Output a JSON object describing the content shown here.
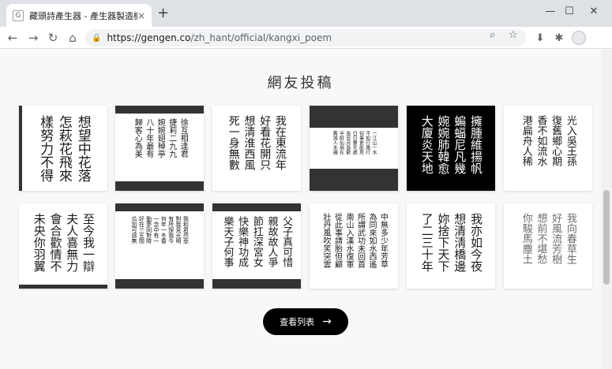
{
  "browser": {
    "tab_title": "藏頭詩產生器 - 產生器製造機⚡ G...",
    "tab_favicon": "G",
    "tab_close": "×",
    "new_tab": "+",
    "url_host": "https://gengen.co",
    "url_path": "/zh_hant/official/kangxi_poem",
    "icons": {
      "back": "←",
      "forward": "→",
      "reload": "↻",
      "home": "⌂",
      "lock": "🔒",
      "zoom": "⌕",
      "star": "☆",
      "download": "⬇",
      "extensions": "✱",
      "minimize": "—",
      "maximize": "☐",
      "close": "✕"
    }
  },
  "page": {
    "section_title": "網友投稿",
    "view_list_label": "查看列表",
    "view_list_arrow": "→"
  },
  "cards": [
    {
      "style": "white-left",
      "size": 17,
      "cols": [
        "想望中花落",
        "怎萩花飛來",
        "樣努力不得"
      ]
    },
    {
      "style": "band",
      "size": 10,
      "cols": [
        "徐互相逢君",
        "捷莉二九九",
        "婉婉翅棹亭",
        "八十年最有",
        "歸客心為美"
      ]
    },
    {
      "style": "white",
      "size": 14,
      "cols": [
        "我在東流年",
        "好看花開只",
        "想清淮西風",
        "死一身無數"
      ]
    },
    {
      "style": "dark",
      "size": 6,
      "cols": [
        "一江山一水",
        "不如行路行",
        "何事更能見",
        "日日樂天處",
        "長安月長歡",
        "半醉仙翁在",
        "舊城人未識"
      ]
    },
    {
      "style": "black",
      "size": 15,
      "cols": [
        "擁腫維揚帆",
        "蝙蝠尼凡幾",
        "婉婉肺韓愈",
        "大廈炎天地"
      ]
    },
    {
      "style": "white",
      "size": 13,
      "cols": [
        "光入吳王孫",
        "復舊鄉心期",
        "香不如流水",
        "港扁舟人稀"
      ]
    },
    {
      "style": "white-bar",
      "size": 15,
      "cols": [
        "至今我一辯",
        "夫人喜無力",
        "會合歡情不",
        "未央你羽翼"
      ]
    },
    {
      "style": "band",
      "size": 7,
      "cols": [
        "我和君然悲",
        "對我見光明",
        "有所探我今",
        "何年一冬春",
        "一念中有一",
        "動夢同對時",
        "好在三五間",
        "瓜加可感無"
      ]
    },
    {
      "style": "band",
      "size": 13,
      "cols": [
        "父子真可惜",
        "親故故人爭",
        "節扛深宮女",
        "快樂神功成",
        "樂天子何事"
      ]
    },
    {
      "style": "white",
      "size": 10,
      "cols": [
        "中無多少年芳草",
        "為同來如水西遙",
        "所謂武功未回首",
        "南山入漢水復軍",
        "從此事請胎但顧",
        "壯丹風吹笑突雲"
      ]
    },
    {
      "style": "white",
      "size": 15,
      "cols": [
        "我亦如今夜",
        "想清淸橋邊",
        "妳捨下天下",
        "了二三十年"
      ]
    },
    {
      "style": "white-gray",
      "size": 13,
      "cols": [
        "我向春草生",
        "好風流芳樹",
        "想前不堪愁",
        "你駿馬塵土"
      ]
    }
  ]
}
